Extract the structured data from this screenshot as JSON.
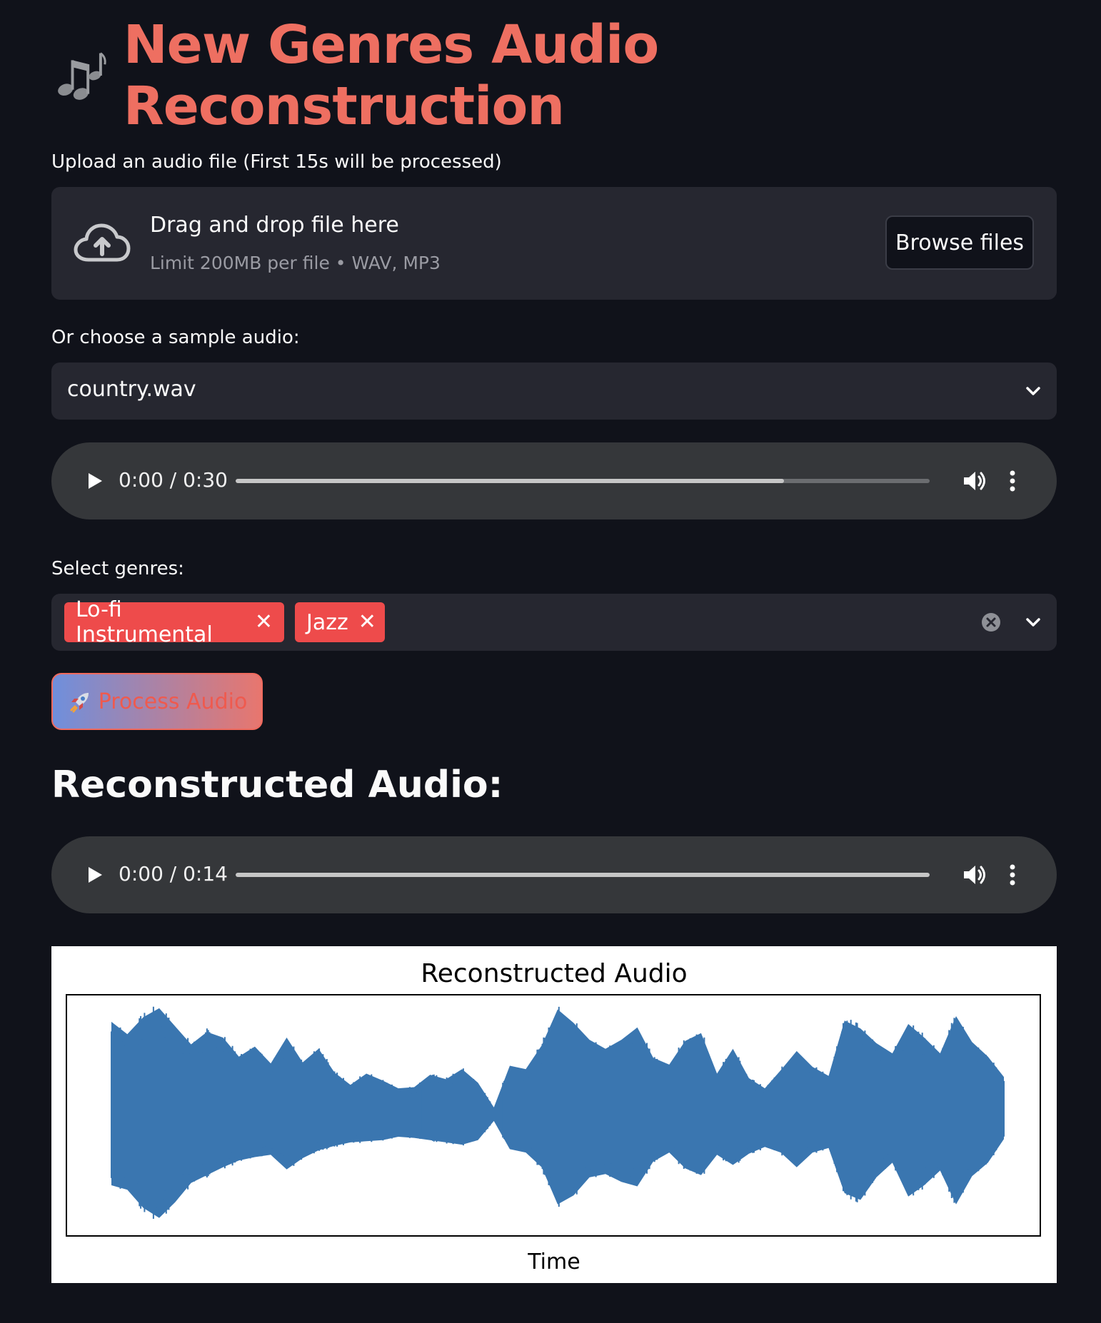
{
  "header": {
    "icon": "musical-notes-icon",
    "title": "New Genres Audio Reconstruction"
  },
  "upload": {
    "label": "Upload an audio file (First 15s will be processed)",
    "drop_text": "Drag and drop file here",
    "limit_text": "Limit 200MB per file • WAV, MP3",
    "browse_label": "Browse files",
    "icon": "cloud-upload-icon"
  },
  "sample": {
    "label": "Or choose a sample audio:",
    "selected": "country.wav"
  },
  "player1": {
    "time": "0:00 / 0:30",
    "progress": 0.79
  },
  "genres": {
    "label": "Select genres:",
    "selected": [
      "Lo-fi Instrumental",
      "Jazz"
    ],
    "tag_color": "#ee4b4b"
  },
  "process": {
    "label": "Process Audio",
    "icon": "rocket-icon"
  },
  "result": {
    "heading": "Reconstructed Audio:"
  },
  "player2": {
    "time": "0:00 / 0:14",
    "progress": 1.0
  },
  "chart_data": {
    "type": "area",
    "title": "Reconstructed Audio",
    "xlabel": "Time",
    "ylabel": "",
    "grid": false,
    "color": "#3a76b0",
    "x": [
      0,
      0.25,
      0.5,
      0.75,
      1,
      1.25,
      1.5,
      1.75,
      2,
      2.25,
      2.5,
      2.75,
      3,
      3.25,
      3.5,
      3.75,
      4,
      4.25,
      4.5,
      4.75,
      5,
      5.25,
      5.5,
      5.75,
      6,
      6.25,
      6.5,
      6.75,
      7,
      7.25,
      7.5,
      7.75,
      8,
      8.25,
      8.5,
      8.75,
      9,
      9.25,
      9.5,
      9.75,
      10,
      10.25,
      10.5,
      10.75,
      11,
      11.25,
      11.5,
      11.75,
      12,
      12.25,
      12.5,
      12.75,
      13,
      13.25,
      13.5,
      13.75,
      14
    ],
    "upper": [
      0.83,
      0.72,
      0.87,
      0.95,
      0.79,
      0.63,
      0.74,
      0.69,
      0.52,
      0.61,
      0.46,
      0.69,
      0.47,
      0.59,
      0.38,
      0.27,
      0.37,
      0.31,
      0.24,
      0.25,
      0.36,
      0.32,
      0.41,
      0.29,
      0.07,
      0.44,
      0.41,
      0.62,
      0.94,
      0.82,
      0.67,
      0.59,
      0.67,
      0.78,
      0.51,
      0.45,
      0.66,
      0.73,
      0.37,
      0.59,
      0.33,
      0.24,
      0.4,
      0.57,
      0.43,
      0.35,
      0.84,
      0.77,
      0.64,
      0.55,
      0.81,
      0.69,
      0.55,
      0.88,
      0.65,
      0.52,
      0.34
    ],
    "lower": [
      -0.62,
      -0.66,
      -0.82,
      -0.91,
      -0.77,
      -0.6,
      -0.53,
      -0.46,
      -0.4,
      -0.37,
      -0.35,
      -0.48,
      -0.38,
      -0.31,
      -0.27,
      -0.24,
      -0.23,
      -0.22,
      -0.19,
      -0.2,
      -0.22,
      -0.24,
      -0.26,
      -0.22,
      -0.05,
      -0.3,
      -0.33,
      -0.46,
      -0.79,
      -0.71,
      -0.55,
      -0.52,
      -0.59,
      -0.63,
      -0.41,
      -0.33,
      -0.47,
      -0.53,
      -0.35,
      -0.44,
      -0.34,
      -0.28,
      -0.33,
      -0.46,
      -0.33,
      -0.29,
      -0.69,
      -0.75,
      -0.55,
      -0.42,
      -0.72,
      -0.62,
      -0.49,
      -0.79,
      -0.54,
      -0.42,
      -0.21
    ],
    "ylim": [
      -1,
      1
    ]
  }
}
